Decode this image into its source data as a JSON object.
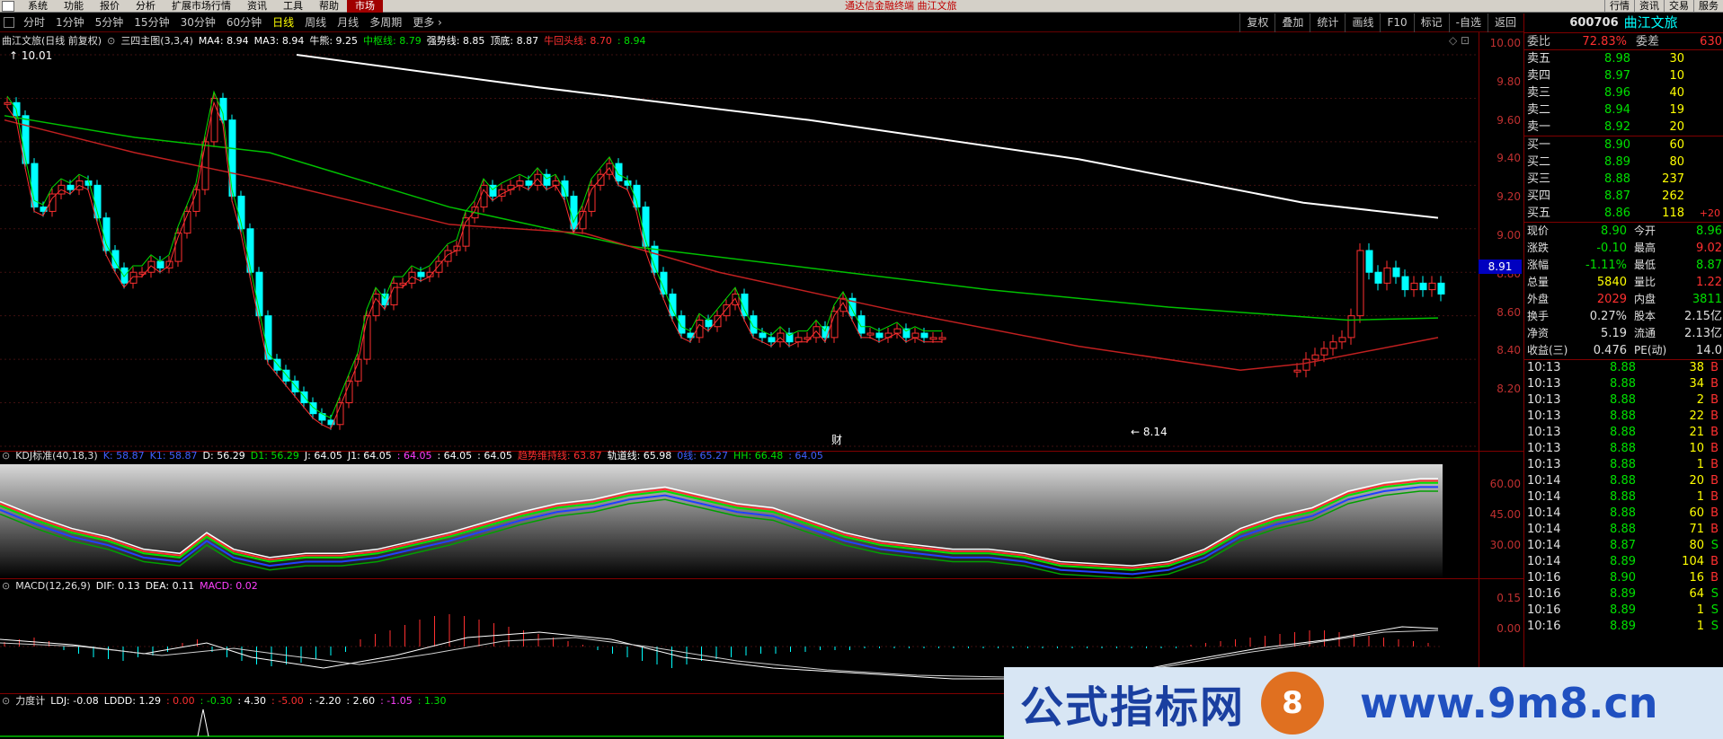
{
  "menubar": {
    "items": [
      "系统",
      "功能",
      "报价",
      "分析",
      "扩展市场行情",
      "资讯",
      "工具",
      "帮助",
      "市场"
    ],
    "active_index": 8,
    "title": "通达信金融终端 曲江文旅",
    "right_items": [
      "行情",
      "资讯",
      "交易",
      "服务"
    ]
  },
  "periodbar": {
    "items": [
      "分时",
      "1分钟",
      "5分钟",
      "15分钟",
      "30分钟",
      "60分钟",
      "日线",
      "周线",
      "月线",
      "多周期",
      "更多 ›"
    ],
    "active_index": 6,
    "tools": [
      "复权",
      "叠加",
      "统计",
      "画线",
      "F10",
      "标记",
      "-自选",
      "返回"
    ]
  },
  "main_chart": {
    "title": "曲江文旅(日线 前复权)",
    "indicator": "三四主图(3,3,4)",
    "values": [
      {
        "label": "MA4: 8.94",
        "color": "#ffffff"
      },
      {
        "label": "MA3: 8.94",
        "color": "#ffffff"
      },
      {
        "label": "牛熊: 9.25",
        "color": "#ffffff"
      },
      {
        "label": "中枢线: 8.79",
        "color": "#00e000"
      },
      {
        "label": "强势线: 8.85",
        "color": "#ffffff"
      },
      {
        "label": "顶底: 8.87",
        "color": "#ffffff"
      },
      {
        "label": "牛回头线: 8.70",
        "color": "#ff3030"
      },
      {
        "label": ": 8.94",
        "color": "#00e000"
      }
    ],
    "high_label": "10.01",
    "low_label": "8.14",
    "cursor_price": "8.91",
    "ticks": [
      "10.00",
      "9.80",
      "9.60",
      "9.40",
      "9.20",
      "9.00",
      "8.80",
      "8.60",
      "8.40",
      "8.20"
    ],
    "marker_cai": "财"
  },
  "kdj": {
    "title": "KDJ标准(40,18,3)",
    "values": [
      {
        "label": "K: 58.87",
        "color": "#4060ff"
      },
      {
        "label": "K1: 58.87",
        "color": "#4060ff"
      },
      {
        "label": "D: 56.29",
        "color": "#ffffff"
      },
      {
        "label": "D1: 56.29",
        "color": "#00e000"
      },
      {
        "label": "J: 64.05",
        "color": "#ffffff"
      },
      {
        "label": "J1: 64.05",
        "color": "#ffffff"
      },
      {
        "label": ": 64.05",
        "color": "#ff40ff"
      },
      {
        "label": ": 64.05",
        "color": "#ffffff"
      },
      {
        "label": ": 64.05",
        "color": "#ffffff"
      },
      {
        "label": "趋势维持线: 63.87",
        "color": "#ff3030"
      },
      {
        "label": "轨道线: 65.98",
        "color": "#ffffff"
      },
      {
        "label": "0线: 65.27",
        "color": "#4060ff"
      },
      {
        "label": "HH: 66.48",
        "color": "#00e000"
      },
      {
        "label": ": 64.05",
        "color": "#4060ff"
      }
    ],
    "ticks": [
      "60.00",
      "45.00",
      "30.00"
    ]
  },
  "macd": {
    "title": "MACD(12,26,9)",
    "values": [
      {
        "label": "DIF: 0.13",
        "color": "#ffffff"
      },
      {
        "label": "DEA: 0.11",
        "color": "#ffffff"
      },
      {
        "label": "MACD: 0.02",
        "color": "#ff40ff"
      }
    ],
    "ticks": [
      "0.15",
      "0.00"
    ]
  },
  "lidu": {
    "title": "力度计",
    "values": [
      {
        "label": "LDJ: -0.08",
        "color": "#ffffff"
      },
      {
        "label": "LDDD: 1.29",
        "color": "#ffffff"
      },
      {
        "label": ": 0.00",
        "color": "#ff3030"
      },
      {
        "label": ": -0.30",
        "color": "#00e000"
      },
      {
        "label": ": 4.30",
        "color": "#ffffff"
      },
      {
        "label": ": -5.00",
        "color": "#ff3030"
      },
      {
        "label": ": -2.20",
        "color": "#ffffff"
      },
      {
        "label": ": 2.60",
        "color": "#ffffff"
      },
      {
        "label": ": -1.05",
        "color": "#ff40ff"
      },
      {
        "label": ": 1.30",
        "color": "#00e000"
      }
    ]
  },
  "quote": {
    "code": "600706",
    "name": "曲江文旅",
    "webi_label": "委比",
    "webi_value": "72.83%",
    "weicha_label": "委差",
    "weicha_value": "630",
    "sell": [
      {
        "label": "卖五",
        "price": "8.98",
        "vol": "30"
      },
      {
        "label": "卖四",
        "price": "8.97",
        "vol": "10"
      },
      {
        "label": "卖三",
        "price": "8.96",
        "vol": "40"
      },
      {
        "label": "卖二",
        "price": "8.94",
        "vol": "19"
      },
      {
        "label": "卖一",
        "price": "8.92",
        "vol": "20"
      }
    ],
    "buy": [
      {
        "label": "买一",
        "price": "8.90",
        "vol": "60",
        "chg": ""
      },
      {
        "label": "买二",
        "price": "8.89",
        "vol": "80",
        "chg": ""
      },
      {
        "label": "买三",
        "price": "8.88",
        "vol": "237",
        "chg": ""
      },
      {
        "label": "买四",
        "price": "8.87",
        "vol": "262",
        "chg": ""
      },
      {
        "label": "买五",
        "price": "8.86",
        "vol": "118",
        "chg": "+20"
      }
    ],
    "stats": [
      {
        "l1": "现价",
        "v1": "8.90",
        "c1": "green",
        "l2": "今开",
        "v2": "8.96",
        "c2": "green"
      },
      {
        "l1": "涨跌",
        "v1": "-0.10",
        "c1": "green",
        "l2": "最高",
        "v2": "9.02",
        "c2": "red"
      },
      {
        "l1": "涨幅",
        "v1": "-1.11%",
        "c1": "green",
        "l2": "最低",
        "v2": "8.87",
        "c2": "green"
      },
      {
        "l1": "总量",
        "v1": "5840",
        "c1": "yellow",
        "l2": "量比",
        "v2": "1.22",
        "c2": "red"
      },
      {
        "l1": "外盘",
        "v1": "2029",
        "c1": "red",
        "l2": "内盘",
        "v2": "3811",
        "c2": "green"
      },
      {
        "l1": "换手",
        "v1": "0.27%",
        "c1": "white",
        "l2": "股本",
        "v2": "2.15亿",
        "c2": "white"
      },
      {
        "l1": "净资",
        "v1": "5.19",
        "c1": "white",
        "l2": "流通",
        "v2": "2.13亿",
        "c2": "white"
      },
      {
        "l1": "收益(三)",
        "v1": "0.476",
        "c1": "white",
        "l2": "PE(动)",
        "v2": "14.0",
        "c2": "white"
      }
    ],
    "ticks": [
      {
        "time": "10:13",
        "price": "8.88",
        "vol": "38",
        "bs": "B"
      },
      {
        "time": "10:13",
        "price": "8.88",
        "vol": "34",
        "bs": "B"
      },
      {
        "time": "10:13",
        "price": "8.88",
        "vol": "2",
        "bs": "B"
      },
      {
        "time": "10:13",
        "price": "8.88",
        "vol": "22",
        "bs": "B"
      },
      {
        "time": "10:13",
        "price": "8.88",
        "vol": "21",
        "bs": "B"
      },
      {
        "time": "10:13",
        "price": "8.88",
        "vol": "10",
        "bs": "B"
      },
      {
        "time": "10:13",
        "price": "8.88",
        "vol": "1",
        "bs": "B"
      },
      {
        "time": "10:14",
        "price": "8.88",
        "vol": "20",
        "bs": "B"
      },
      {
        "time": "10:14",
        "price": "8.88",
        "vol": "1",
        "bs": "B"
      },
      {
        "time": "10:14",
        "price": "8.88",
        "vol": "60",
        "bs": "B"
      },
      {
        "time": "10:14",
        "price": "8.88",
        "vol": "71",
        "bs": "B"
      },
      {
        "time": "10:14",
        "price": "8.87",
        "vol": "80",
        "bs": "S"
      },
      {
        "time": "10:14",
        "price": "8.89",
        "vol": "104",
        "bs": "B"
      },
      {
        "time": "10:16",
        "price": "8.90",
        "vol": "16",
        "bs": "B"
      },
      {
        "time": "10:16",
        "price": "8.89",
        "vol": "64",
        "bs": "S"
      },
      {
        "time": "10:16",
        "price": "8.89",
        "vol": "1",
        "bs": "S"
      },
      {
        "time": "10:16",
        "price": "8.89",
        "vol": "1",
        "bs": "S"
      }
    ]
  },
  "watermark": {
    "text": "公式指标网",
    "url": "www.9m8.cn",
    "logo_char": "8"
  },
  "colors": {
    "up": "#ff3030",
    "down": "#00ffff",
    "ma_white": "#ffffff",
    "ma_green": "#00c000",
    "ma_red": "#c02020"
  }
}
